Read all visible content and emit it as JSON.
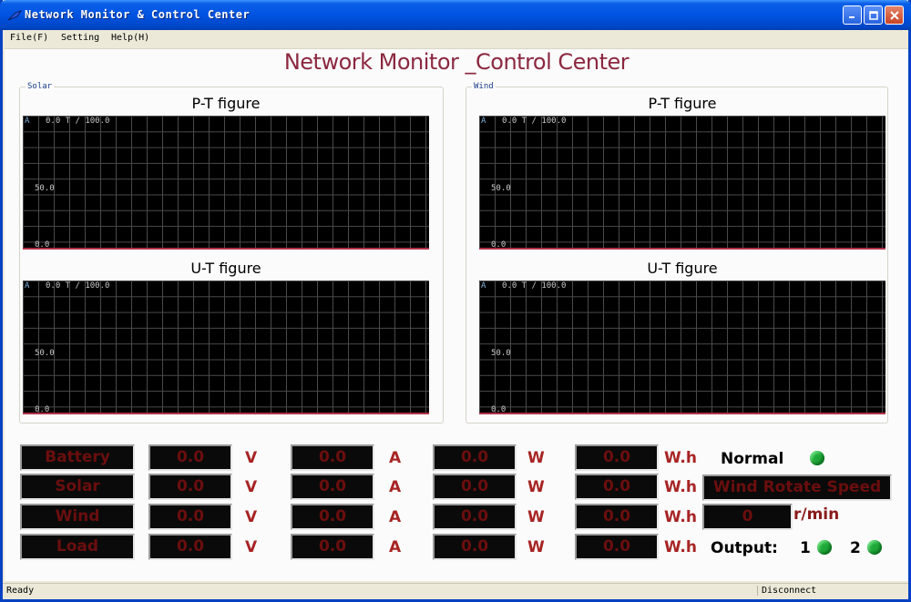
{
  "window": {
    "title": "Network Monitor & Control Center",
    "min_icon": "minimize-icon",
    "max_icon": "maximize-icon",
    "close_icon": "close-icon"
  },
  "menu": {
    "file": "File(F)",
    "setting": "Setting",
    "help": "Help(H)"
  },
  "app_title": "Network Monitor _Control Center",
  "groups": {
    "solar": {
      "label": "Solar"
    },
    "wind": {
      "label": "Wind"
    }
  },
  "figures": {
    "pt_title": "P-T figure",
    "ut_title": "U-T figure",
    "axis_unit": "A",
    "axis_top": "0.0 T /   100.0",
    "axis_mid": "50.0",
    "axis_bot": "0.0"
  },
  "rows": [
    {
      "name": "Battery",
      "v": "0.0",
      "a": "0.0",
      "w": "0.0",
      "wh": "0.0"
    },
    {
      "name": "Solar",
      "v": "0.0",
      "a": "0.0",
      "w": "0.0",
      "wh": "0.0"
    },
    {
      "name": "Wind",
      "v": "0.0",
      "a": "0.0",
      "w": "0.0",
      "wh": "0.0"
    },
    {
      "name": "Load",
      "v": "0.0",
      "a": "0.0",
      "w": "0.0",
      "wh": "0.0"
    }
  ],
  "units": {
    "v": "V",
    "a": "A",
    "w": "W",
    "wh": "W.h"
  },
  "status": {
    "normal": "Normal",
    "wind_speed_label": "Wind Rotate Speed",
    "wind_speed_value": "0",
    "wind_speed_unit": "r/min",
    "output_label": "Output:",
    "output_1": "1",
    "output_2": "2"
  },
  "colors": {
    "led_on": "#1fa838",
    "lcd_text": "#6b0e0e",
    "unit": "#a82424",
    "title": "#8b2840"
  },
  "statusbar": {
    "left": "Ready",
    "right": "Disconnect"
  }
}
